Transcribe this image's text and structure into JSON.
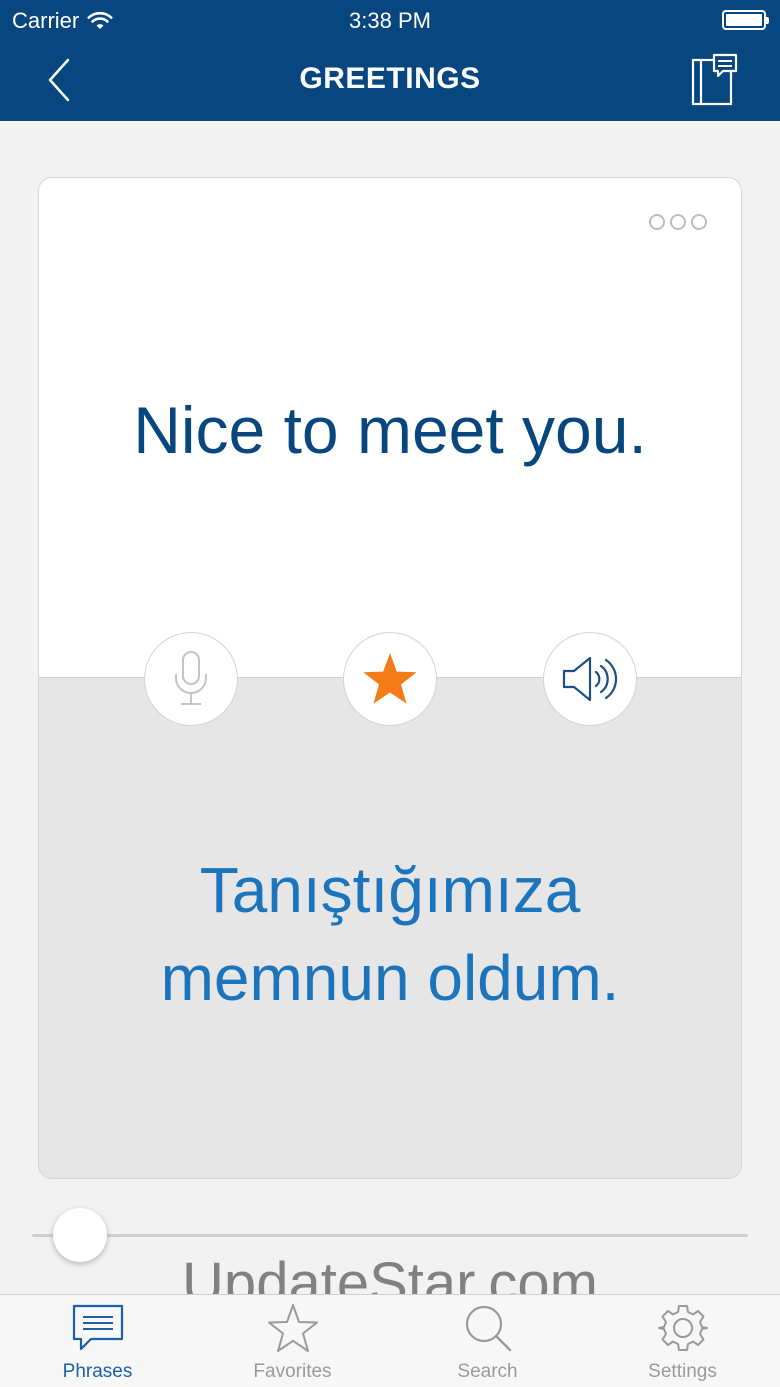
{
  "status_bar": {
    "carrier": "Carrier",
    "time": "3:38 PM"
  },
  "nav": {
    "title": "GREETINGS"
  },
  "card": {
    "phrase": "Nice to meet you.",
    "translation_line1": "Tanıştığımıza",
    "translation_line2": "memnun oldum."
  },
  "slider": {
    "position_fraction": 0.06
  },
  "watermark": "UpdateStar.com",
  "tabs": [
    {
      "label": "Phrases",
      "icon": "speech-bubble-icon",
      "active": true
    },
    {
      "label": "Favorites",
      "icon": "star-icon",
      "active": false
    },
    {
      "label": "Search",
      "icon": "search-icon",
      "active": false
    },
    {
      "label": "Settings",
      "icon": "gear-icon",
      "active": false
    }
  ],
  "colors": {
    "nav_background": "#08467f",
    "phrase_text": "#08467f",
    "translation_text": "#1c75bc",
    "favorite_star": "#f47b16",
    "active_tab": "#1c5fa8"
  }
}
